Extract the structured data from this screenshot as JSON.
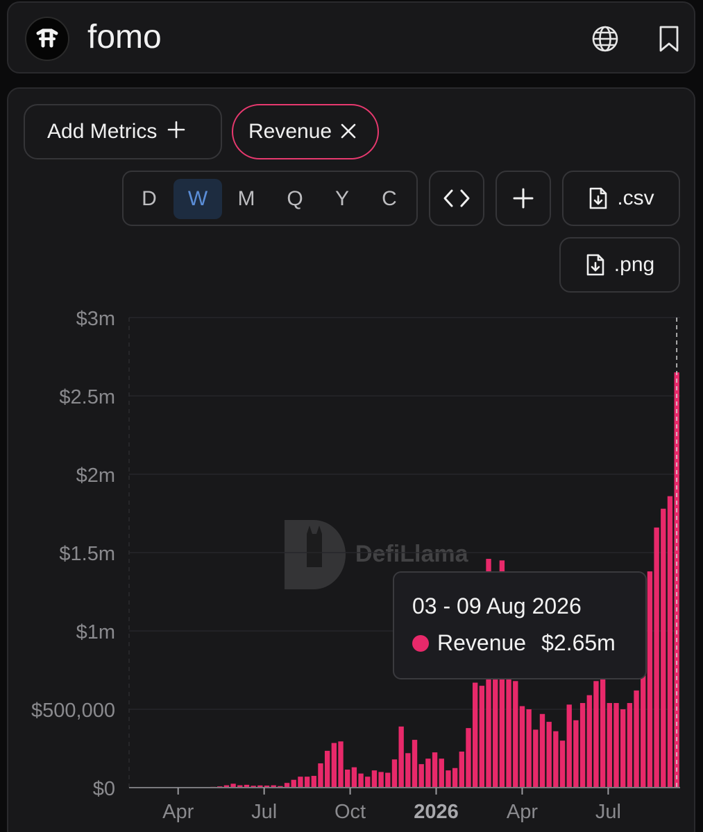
{
  "header": {
    "app_name": "fomo",
    "icons": [
      "logo-icon",
      "globe-icon",
      "bookmark-icon"
    ]
  },
  "metrics": {
    "add_label": "Add Metrics",
    "add_icon": "plus-icon",
    "active_metric": "Revenue",
    "remove_icon": "close-icon",
    "active_color": "#e8396f"
  },
  "range": {
    "options": [
      "D",
      "W",
      "M",
      "Q",
      "Y",
      "C"
    ],
    "selected": "W",
    "selected_color": "#5b8ed8"
  },
  "tools": {
    "embed_icon": "code-icon",
    "add_icon": "plus-icon",
    "csv_label": ".csv",
    "png_label": ".png",
    "download_icon": "file-download-icon"
  },
  "watermark": {
    "text": "DefiLlama"
  },
  "tooltip": {
    "date": "03 - 09 Aug 2026",
    "series": "Revenue",
    "value": "$2.65m"
  },
  "chart_data": {
    "type": "bar",
    "bar_color": "#e8296a",
    "grid": true,
    "y_ticks": [
      "$0",
      "$500,000",
      "$1m",
      "$1.5m",
      "$2m",
      "$2.5m",
      "$3m"
    ],
    "y_tick_values": [
      0,
      500000,
      1000000,
      1500000,
      2000000,
      2500000,
      3000000
    ],
    "ylim": [
      0,
      3000000
    ],
    "x_ticks": [
      "Apr",
      "Jul",
      "Oct",
      "2026",
      "Apr",
      "Jul"
    ],
    "x_tick_positions": [
      7.3,
      20.1,
      32.9,
      45.7,
      58.5,
      71.3
    ],
    "series": [
      {
        "name": "Revenue",
        "values": [
          0,
          0,
          0,
          0,
          0,
          0,
          0,
          0,
          0,
          0,
          3000,
          4000,
          5000,
          8000,
          15000,
          25000,
          15000,
          18000,
          12000,
          14000,
          13000,
          15000,
          10000,
          30000,
          50000,
          70000,
          70000,
          75000,
          155000,
          235000,
          285000,
          295000,
          115000,
          130000,
          90000,
          70000,
          110000,
          100000,
          95000,
          180000,
          390000,
          220000,
          305000,
          150000,
          185000,
          225000,
          185000,
          110000,
          125000,
          230000,
          380000,
          670000,
          650000,
          1460000,
          690000,
          1450000,
          1000000,
          680000,
          520000,
          500000,
          370000,
          470000,
          420000,
          360000,
          300000,
          530000,
          430000,
          540000,
          590000,
          680000,
          1100000,
          540000,
          540000,
          500000,
          540000,
          620000,
          960000,
          1380000,
          1660000,
          1780000,
          1860000,
          2650000
        ]
      }
    ]
  }
}
